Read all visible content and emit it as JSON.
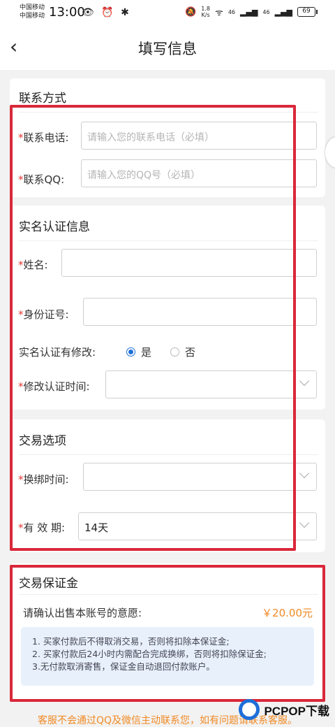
{
  "status": {
    "carrier1": "中国移动",
    "carrier2": "中国移动",
    "time": "13:00",
    "left_icons": "👁 ⏰ ✱",
    "speed": "1.8",
    "speed_unit": "K/s",
    "sig1": "46",
    "sig2": "46",
    "battery": "69"
  },
  "nav": {
    "back": "‹",
    "title": "填写信息"
  },
  "contact": {
    "title": "联系方式",
    "phone_label": "联系电话:",
    "phone_placeholder": "请输入您的联系电话（必填）",
    "qq_label": "联系QQ:",
    "qq_placeholder": "请输入您的QQ号（必填）"
  },
  "realname": {
    "title": "实名认证信息",
    "name_label": "姓名:",
    "id_label": "身份证号:",
    "modified_label": "实名认证有修改:",
    "yes": "是",
    "no": "否",
    "selected": "是",
    "modify_time_label": "修改认证时间:"
  },
  "trade": {
    "title": "交易选项",
    "rebind_label": "换绑时间:",
    "validity_label": "有 效 期:",
    "validity_value": "14天"
  },
  "deposit": {
    "title": "交易保证金",
    "question": "请确认出售本账号的意愿:",
    "amount": "￥20.00元",
    "notes": [
      "1. 买家付款后不得取消交易，否则将扣除本保证金;",
      "2. 买家付款后24小时内需配合完成换绑，否则将扣除保证金;",
      "3.无付款取消寄售，保证金自动退回付款账户。"
    ]
  },
  "footer": {
    "note": "客服不会通过QQ及微信主动联系您，如有问题请联系客服。"
  },
  "watermark": {
    "text": "PCPOP下载"
  },
  "colors": {
    "required": "#e53935",
    "highlight": "#d9283a",
    "accent": "#f08a24",
    "radio": "#1e6fd9"
  }
}
